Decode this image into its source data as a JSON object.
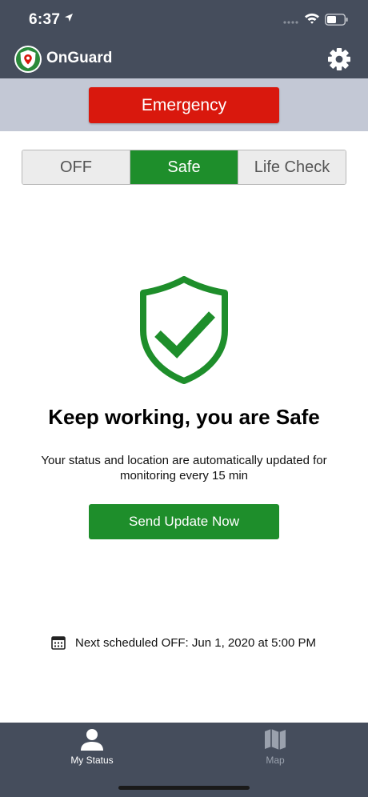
{
  "status_bar": {
    "time": "6:37"
  },
  "app_bar": {
    "title": "OnGuard"
  },
  "emergency": {
    "label": "Emergency"
  },
  "mode_selector": {
    "options": [
      {
        "label": "OFF",
        "selected": false
      },
      {
        "label": "Safe",
        "selected": true
      },
      {
        "label": "Life Check",
        "selected": false
      }
    ]
  },
  "status_panel": {
    "headline": "Keep working, you are Safe",
    "description": "Your status and location are automatically updated for monitoring every 15 min",
    "send_button_label": "Send Update Now",
    "next_schedule": "Next scheduled OFF: Jun 1, 2020 at 5:00 PM"
  },
  "tab_bar": {
    "tabs": [
      {
        "label": "My Status",
        "icon": "person-icon",
        "active": true
      },
      {
        "label": "Map",
        "icon": "map-icon",
        "active": false
      }
    ]
  },
  "colors": {
    "header_bg": "#454d5c",
    "emergency_band_bg": "#c3c8d5",
    "emergency_red": "#d9180d",
    "safe_green": "#1e8e2b",
    "segment_inactive_bg": "#ececec"
  }
}
